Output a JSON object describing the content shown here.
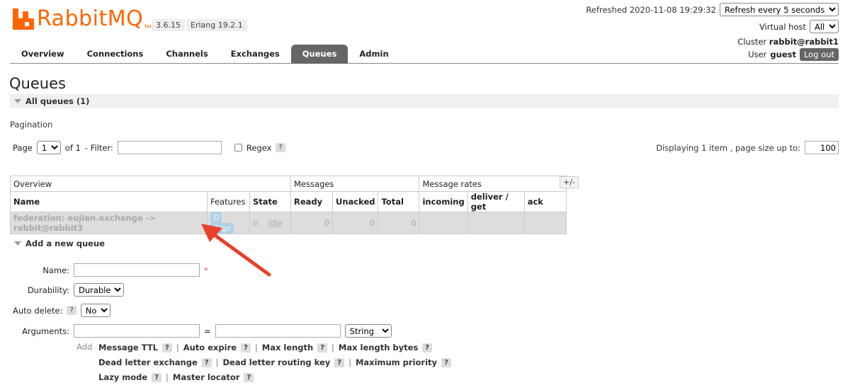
{
  "header": {
    "logo_text": "RabbitMQ",
    "logo_tm": "TM",
    "version": "3.6.15",
    "erlang": "Erlang 19.2.1",
    "refreshed_label": "Refreshed 2020-11-08 19:29:32",
    "refresh_option": "Refresh every 5 seconds",
    "vhost_label": "Virtual host",
    "vhost_value": "All",
    "cluster_label": "Cluster",
    "cluster_value": "rabbit@rabbit1",
    "user_label": "User",
    "user_value": "guest",
    "logout_label": "Log out"
  },
  "nav": {
    "tabs": [
      {
        "label": "Overview"
      },
      {
        "label": "Connections"
      },
      {
        "label": "Channels"
      },
      {
        "label": "Exchanges"
      },
      {
        "label": "Queues"
      },
      {
        "label": "Admin"
      }
    ]
  },
  "page": {
    "title": "Queues",
    "all_queues_label": "All queues (1)",
    "pagination_label": "Pagination",
    "page_label": "Page",
    "page_value": "1",
    "of_label": "of 1",
    "filter_label": "- Filter:",
    "regex_label": "Regex",
    "help_mark": "?",
    "displaying_label": "Displaying 1 item , page size up to:",
    "page_size": "100"
  },
  "table": {
    "group_headers": [
      "Overview",
      "Messages",
      "Message rates"
    ],
    "plusminus": "+/-",
    "columns": [
      "Name",
      "Features",
      "State",
      "Ready",
      "Unacked",
      "Total",
      "incoming",
      "deliver / get",
      "ack"
    ],
    "rows": [
      {
        "name": "federation: eujian.exchange -> rabbit@rabbit3",
        "feature_d": "D",
        "feature_args": "Args",
        "state": "idle",
        "ready": "0",
        "unacked": "0",
        "total": "0",
        "incoming": "",
        "deliver": "",
        "ack": ""
      }
    ]
  },
  "add_queue": {
    "section_label": "Add a new queue",
    "name_label": "Name:",
    "required_mark": "*",
    "durability_label": "Durability:",
    "durability_value": "Durable",
    "auto_delete_label": "Auto delete:",
    "auto_delete_value": "No",
    "arguments_label": "Arguments:",
    "equals": "=",
    "arg_type": "String",
    "add_label": "Add",
    "helpers_row1": [
      "Message TTL",
      "Auto expire",
      "Max length",
      "Max length bytes"
    ],
    "helpers_row2": [
      "Dead letter exchange",
      "Dead letter routing key",
      "Maximum priority"
    ],
    "helpers_row3": [
      "Lazy mode",
      "Master locator"
    ],
    "separator": "|"
  },
  "colors": {
    "brand": "#ff6600",
    "tab_active": "#666666",
    "annotation_arrow": "#e8402a"
  }
}
